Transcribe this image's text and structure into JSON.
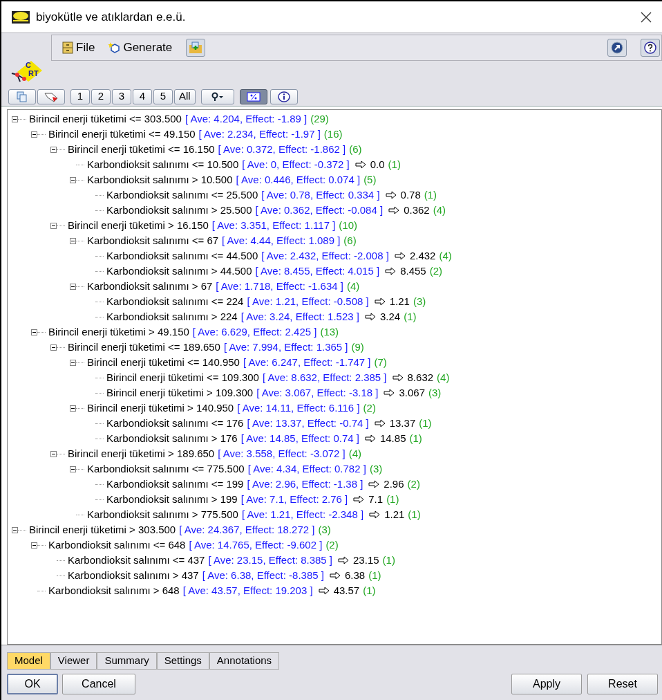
{
  "window": {
    "title": "biyokütle ve atıklardan e.e.ü."
  },
  "menu": [
    {
      "label": "File",
      "kind": "file"
    },
    {
      "label": "Generate",
      "kind": "generate"
    }
  ],
  "logo_letters": [
    "C",
    "RT"
  ],
  "toolbar": {
    "levels": [
      {
        "label": "1"
      },
      {
        "label": "2"
      },
      {
        "label": "3"
      },
      {
        "label": "4"
      },
      {
        "label": "5"
      },
      {
        "label": "All"
      }
    ],
    "percent_toggle": {
      "on": true
    }
  },
  "tree": [
    {
      "condition": "Birincil enerji tüketimi <= 303.500",
      "stats": "[ Ave: 4.204, Effect: -1.89 ]",
      "count": "(29)",
      "expanded": true,
      "children": [
        {
          "condition": "Birincil enerji tüketimi <= 49.150",
          "stats": "[ Ave: 2.234, Effect: -1.97 ]",
          "count": "(16)",
          "expanded": true,
          "children": [
            {
              "condition": "Birincil enerji tüketimi <= 16.150",
              "stats": "[ Ave: 0.372, Effect: -1.862 ]",
              "count": "(6)",
              "expanded": true,
              "children": [
                {
                  "condition": "Karbondioksit salınımı <= 10.500",
                  "stats": "[ Ave: 0, Effect: -0.372 ]",
                  "result": "0.0",
                  "count": "(1)"
                },
                {
                  "condition": "Karbondioksit salınımı > 10.500",
                  "stats": "[ Ave: 0.446, Effect: 0.074 ]",
                  "count": "(5)",
                  "expanded": true,
                  "children": [
                    {
                      "condition": "Karbondioksit salınımı <= 25.500",
                      "stats": "[ Ave: 0.78, Effect: 0.334 ]",
                      "result": "0.78",
                      "count": "(1)"
                    },
                    {
                      "condition": "Karbondioksit salınımı > 25.500",
                      "stats": "[ Ave: 0.362, Effect: -0.084 ]",
                      "result": "0.362",
                      "count": "(4)"
                    }
                  ]
                }
              ]
            },
            {
              "condition": "Birincil enerji tüketimi > 16.150",
              "stats": "[ Ave: 3.351, Effect: 1.117 ]",
              "count": "(10)",
              "expanded": true,
              "children": [
                {
                  "condition": "Karbondioksit salınımı <= 67",
                  "stats": "[ Ave: 4.44, Effect: 1.089 ]",
                  "count": "(6)",
                  "expanded": true,
                  "children": [
                    {
                      "condition": "Karbondioksit salınımı <= 44.500",
                      "stats": "[ Ave: 2.432, Effect: -2.008 ]",
                      "result": "2.432",
                      "count": "(4)"
                    },
                    {
                      "condition": "Karbondioksit salınımı > 44.500",
                      "stats": "[ Ave: 8.455, Effect: 4.015 ]",
                      "result": "8.455",
                      "count": "(2)"
                    }
                  ]
                },
                {
                  "condition": "Karbondioksit salınımı > 67",
                  "stats": "[ Ave: 1.718, Effect: -1.634 ]",
                  "count": "(4)",
                  "expanded": true,
                  "children": [
                    {
                      "condition": "Karbondioksit salınımı <= 224",
                      "stats": "[ Ave: 1.21, Effect: -0.508 ]",
                      "result": "1.21",
                      "count": "(3)"
                    },
                    {
                      "condition": "Karbondioksit salınımı > 224",
                      "stats": "[ Ave: 3.24, Effect: 1.523 ]",
                      "result": "3.24",
                      "count": "(1)"
                    }
                  ]
                }
              ]
            }
          ]
        },
        {
          "condition": "Birincil enerji tüketimi > 49.150",
          "stats": "[ Ave: 6.629, Effect: 2.425 ]",
          "count": "(13)",
          "expanded": true,
          "children": [
            {
              "condition": "Birincil enerji tüketimi <= 189.650",
              "stats": "[ Ave: 7.994, Effect: 1.365 ]",
              "count": "(9)",
              "expanded": true,
              "children": [
                {
                  "condition": "Birincil enerji tüketimi <= 140.950",
                  "stats": "[ Ave: 6.247, Effect: -1.747 ]",
                  "count": "(7)",
                  "expanded": true,
                  "children": [
                    {
                      "condition": "Birincil enerji tüketimi <= 109.300",
                      "stats": "[ Ave: 8.632, Effect: 2.385 ]",
                      "result": "8.632",
                      "count": "(4)"
                    },
                    {
                      "condition": "Birincil enerji tüketimi > 109.300",
                      "stats": "[ Ave: 3.067, Effect: -3.18 ]",
                      "result": "3.067",
                      "count": "(3)"
                    }
                  ]
                },
                {
                  "condition": "Birincil enerji tüketimi > 140.950",
                  "stats": "[ Ave: 14.11, Effect: 6.116 ]",
                  "count": "(2)",
                  "expanded": true,
                  "children": [
                    {
                      "condition": "Karbondioksit salınımı <= 176",
                      "stats": "[ Ave: 13.37, Effect: -0.74 ]",
                      "result": "13.37",
                      "count": "(1)"
                    },
                    {
                      "condition": "Karbondioksit salınımı > 176",
                      "stats": "[ Ave: 14.85, Effect: 0.74 ]",
                      "result": "14.85",
                      "count": "(1)"
                    }
                  ]
                }
              ]
            },
            {
              "condition": "Birincil enerji tüketimi > 189.650",
              "stats": "[ Ave: 3.558, Effect: -3.072 ]",
              "count": "(4)",
              "expanded": true,
              "children": [
                {
                  "condition": "Karbondioksit salınımı <= 775.500",
                  "stats": "[ Ave: 4.34, Effect: 0.782 ]",
                  "count": "(3)",
                  "expanded": true,
                  "children": [
                    {
                      "condition": "Karbondioksit salınımı <= 199",
                      "stats": "[ Ave: 2.96, Effect: -1.38 ]",
                      "result": "2.96",
                      "count": "(2)"
                    },
                    {
                      "condition": "Karbondioksit salınımı > 199",
                      "stats": "[ Ave: 7.1, Effect: 2.76 ]",
                      "result": "7.1",
                      "count": "(1)"
                    }
                  ]
                },
                {
                  "condition": "Karbondioksit salınımı > 775.500",
                  "stats": "[ Ave: 1.21, Effect: -2.348 ]",
                  "result": "1.21",
                  "count": "(1)"
                }
              ]
            }
          ]
        }
      ]
    },
    {
      "condition": "Birincil enerji tüketimi > 303.500",
      "stats": "[ Ave: 24.367, Effect: 18.272 ]",
      "count": "(3)",
      "expanded": true,
      "children": [
        {
          "condition": "Karbondioksit salınımı <= 648",
          "stats": "[ Ave: 14.765, Effect: -9.602 ]",
          "count": "(2)",
          "expanded": true,
          "children": [
            {
              "condition": "Karbondioksit salınımı <= 437",
              "stats": "[ Ave: 23.15, Effect: 8.385 ]",
              "result": "23.15",
              "count": "(1)"
            },
            {
              "condition": "Karbondioksit salınımı > 437",
              "stats": "[ Ave: 6.38, Effect: -8.385 ]",
              "result": "6.38",
              "count": "(1)"
            }
          ]
        },
        {
          "condition": "Karbondioksit salınımı > 648",
          "stats": "[ Ave: 43.57, Effect: 19.203 ]",
          "result": "43.57",
          "count": "(1)"
        }
      ]
    }
  ],
  "tabs": [
    {
      "label": "Model",
      "selected": true
    },
    {
      "label": "Viewer",
      "selected": false
    },
    {
      "label": "Summary",
      "selected": false
    },
    {
      "label": "Settings",
      "selected": false
    },
    {
      "label": "Annotations",
      "selected": false
    }
  ],
  "buttons_left": [
    {
      "label": "OK",
      "default": true
    },
    {
      "label": "Cancel",
      "default": false
    }
  ],
  "buttons_right": [
    {
      "label": "Apply"
    },
    {
      "label": "Reset"
    }
  ]
}
